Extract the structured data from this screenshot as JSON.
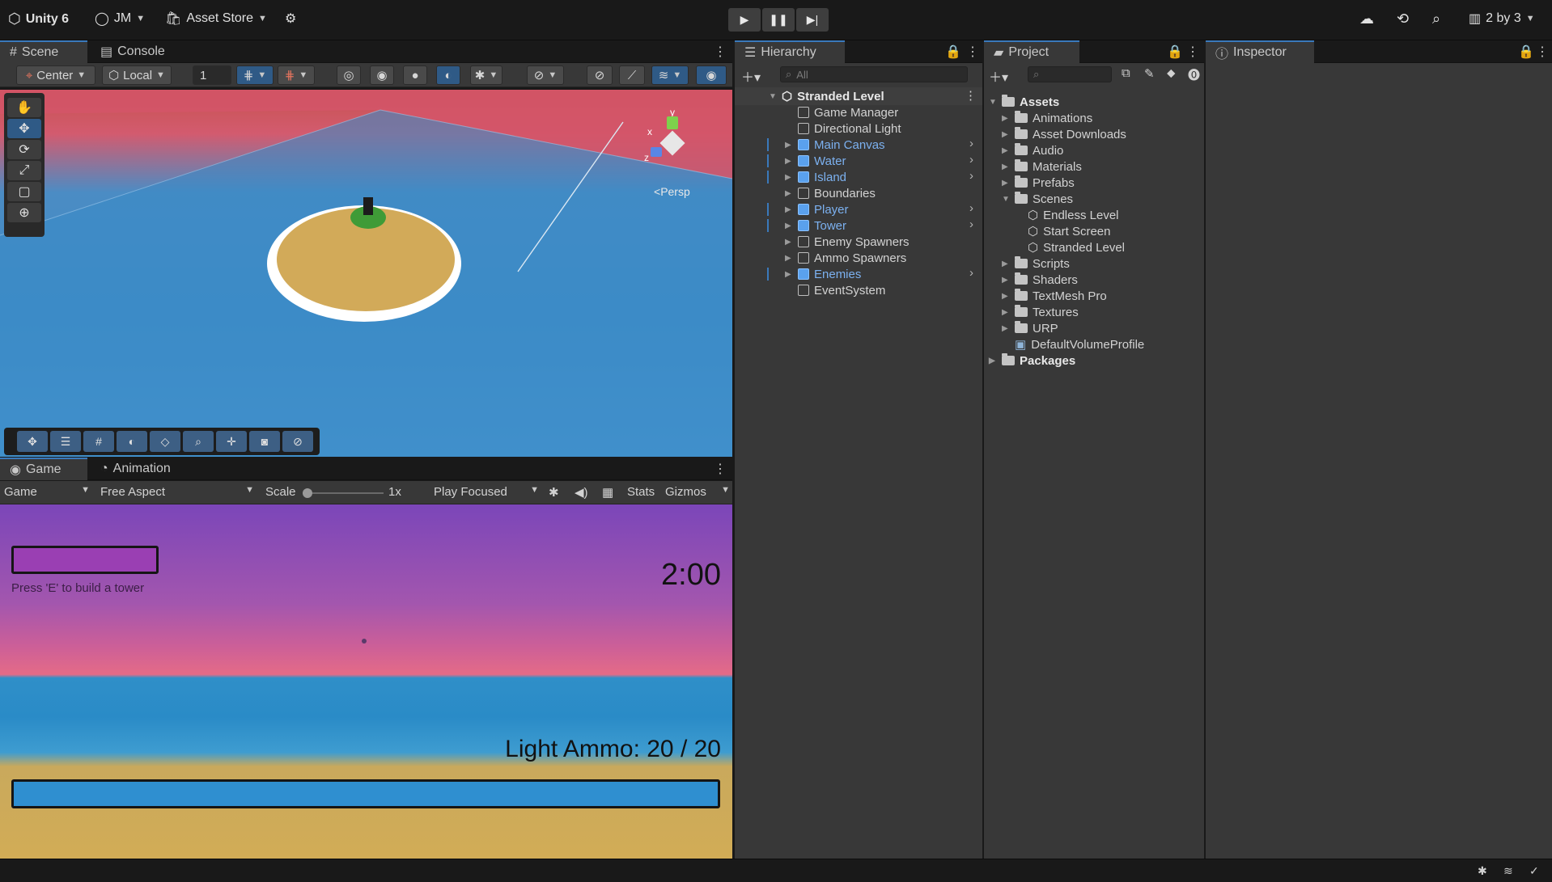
{
  "topbar": {
    "app_title": "Unity 6",
    "account": "JM",
    "asset_store": "Asset Store",
    "layout": "2 by 3"
  },
  "scene_panel": {
    "tabs": [
      "Scene",
      "Console"
    ],
    "pivot": "Center",
    "space": "Local",
    "grid_value": "1",
    "persp_label": "Persp",
    "gizmo_axes": {
      "y": "y",
      "x": "x",
      "z": "z"
    }
  },
  "game_panel": {
    "tabs": [
      "Game",
      "Animation"
    ],
    "display": "Game",
    "aspect": "Free Aspect",
    "scale_label": "Scale",
    "scale_value": "1x",
    "scale_fraction": 0.0,
    "play_mode": "Play Focused",
    "stats": "Stats",
    "gizmos": "Gizmos",
    "hud": {
      "hint": "Press 'E' to build a tower",
      "timer": "2:00",
      "ammo": "Light Ammo: 20 / 20"
    }
  },
  "hierarchy": {
    "tab": "Hierarchy",
    "search_placeholder": "All",
    "scene_name": "Stranded Level",
    "items": [
      {
        "label": "Game Manager",
        "prefab": false,
        "expandable": false
      },
      {
        "label": "Directional Light",
        "prefab": false,
        "expandable": false
      },
      {
        "label": "Main Canvas",
        "prefab": true,
        "expandable": true
      },
      {
        "label": "Water",
        "prefab": true,
        "expandable": true
      },
      {
        "label": "Island",
        "prefab": true,
        "expandable": true
      },
      {
        "label": "Boundaries",
        "prefab": false,
        "expandable": true
      },
      {
        "label": "Player",
        "prefab": true,
        "expandable": true
      },
      {
        "label": "Tower",
        "prefab": true,
        "expandable": true
      },
      {
        "label": "Enemy Spawners",
        "prefab": false,
        "expandable": true
      },
      {
        "label": "Ammo Spawners",
        "prefab": false,
        "expandable": true
      },
      {
        "label": "Enemies",
        "prefab": true,
        "expandable": true
      },
      {
        "label": "EventSystem",
        "prefab": false,
        "expandable": false
      }
    ]
  },
  "project": {
    "tab": "Project",
    "root": "Assets",
    "folders": [
      "Animations",
      "Asset Downloads",
      "Audio",
      "Materials",
      "Prefabs",
      "Scenes"
    ],
    "scenes": [
      "Endless Level",
      "Start Screen",
      "Stranded Level"
    ],
    "folders_after": [
      "Scripts",
      "Shaders",
      "TextMesh Pro",
      "Textures",
      "URP"
    ],
    "file": "DefaultVolumeProfile",
    "packages": "Packages"
  },
  "inspector": {
    "tab": "Inspector"
  },
  "colors": {
    "accent": "#3a79bb",
    "prefab_blue": "#7cb1f0",
    "panel_bg": "#383838"
  }
}
